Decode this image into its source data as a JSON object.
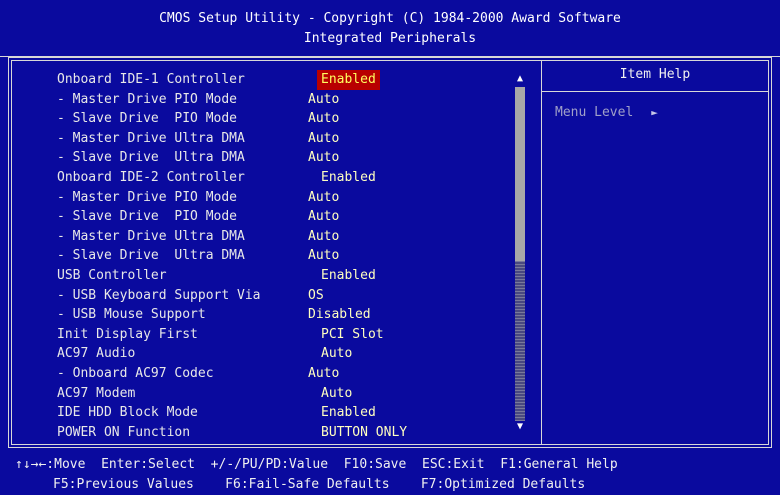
{
  "header": {
    "title": "CMOS Setup Utility - Copyright (C) 1984-2000 Award Software",
    "subtitle": "Integrated Peripherals"
  },
  "settings": [
    {
      "label": "Onboard IDE-1 Controller",
      "value": "Enabled",
      "selected": true
    },
    {
      "label": "- Master Drive PIO Mode",
      "value": "Auto"
    },
    {
      "label": "- Slave Drive  PIO Mode",
      "value": "Auto"
    },
    {
      "label": "- Master Drive Ultra DMA",
      "value": "Auto"
    },
    {
      "label": "- Slave Drive  Ultra DMA",
      "value": "Auto"
    },
    {
      "label": "Onboard IDE-2 Controller",
      "value": "Enabled"
    },
    {
      "label": "- Master Drive PIO Mode",
      "value": "Auto"
    },
    {
      "label": "- Slave Drive  PIO Mode",
      "value": "Auto"
    },
    {
      "label": "- Master Drive Ultra DMA",
      "value": "Auto"
    },
    {
      "label": "- Slave Drive  Ultra DMA",
      "value": "Auto"
    },
    {
      "label": "USB Controller",
      "value": "Enabled"
    },
    {
      "label": "- USB Keyboard Support Via",
      "value": "OS"
    },
    {
      "label": "- USB Mouse Support",
      "value": "Disabled"
    },
    {
      "label": "Init Display First",
      "value": "PCI Slot"
    },
    {
      "label": "AC97 Audio",
      "value": "Auto"
    },
    {
      "label": "- Onboard AC97 Codec",
      "value": "Auto"
    },
    {
      "label": "AC97 Modem",
      "value": "Auto"
    },
    {
      "label": "IDE HDD Block Mode",
      "value": "Enabled"
    },
    {
      "label": "POWER ON Function",
      "value": "BUTTON ONLY"
    }
  ],
  "scrollbar": {
    "up_icon": "▲",
    "down_icon": "▼"
  },
  "help": {
    "title": "Item Help",
    "menu_level_label": "Menu Level",
    "menu_level_arrow": "►"
  },
  "footer": {
    "line1": "↑↓→←:Move  Enter:Select  +/-/PU/PD:Value  F10:Save  ESC:Exit  F1:General Help",
    "line2": "F5:Previous Values    F6:Fail-Safe Defaults    F7:Optimized Defaults"
  },
  "colors": {
    "background": "#0a0a9e",
    "text": "#e8e8e8",
    "value_text": "#ffffc0",
    "selected_bg": "#b80000",
    "selected_text": "#ffff60"
  }
}
